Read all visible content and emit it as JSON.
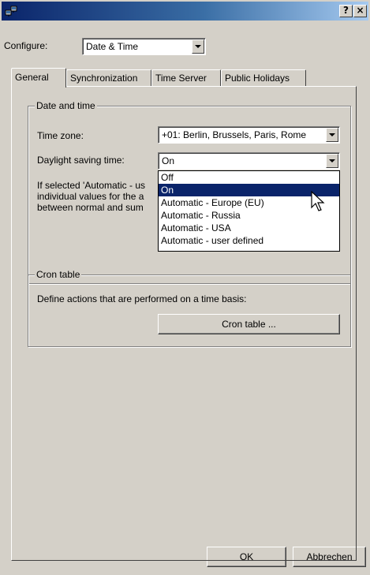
{
  "window": {
    "help_button": "?",
    "close_button": "×"
  },
  "configure": {
    "label": "Configure:",
    "value": "Date & Time"
  },
  "tabs": [
    {
      "label": "General",
      "active": true
    },
    {
      "label": "Synchronization",
      "active": false
    },
    {
      "label": "Time Server",
      "active": false
    },
    {
      "label": "Public Holidays",
      "active": false
    }
  ],
  "date_time_group": {
    "title": "Date and time",
    "timezone_label": "Time zone:",
    "timezone_value": "+01: Berlin, Brussels, Paris, Rome",
    "dst_label": "Daylight saving time:",
    "dst_value": "On",
    "info_line1": "If selected 'Automatic - us",
    "info_line2": "individual values for the a",
    "info_line3": "between normal and sum"
  },
  "dst_options": [
    "Off",
    "On",
    "Automatic - Europe (EU)",
    "Automatic - Russia",
    "Automatic - USA",
    "Automatic - user defined"
  ],
  "dst_selected_index": 1,
  "cron_group": {
    "title": "Cron table",
    "description": "Define actions that are performed on a time basis:",
    "button": "Cron table ..."
  },
  "footer": {
    "ok": "OK",
    "cancel": "Abbrechen"
  },
  "colors": {
    "titlebar_start": "#0a246a",
    "titlebar_end": "#a6caf0",
    "selection": "#0a246a",
    "face": "#d4d0c8"
  }
}
